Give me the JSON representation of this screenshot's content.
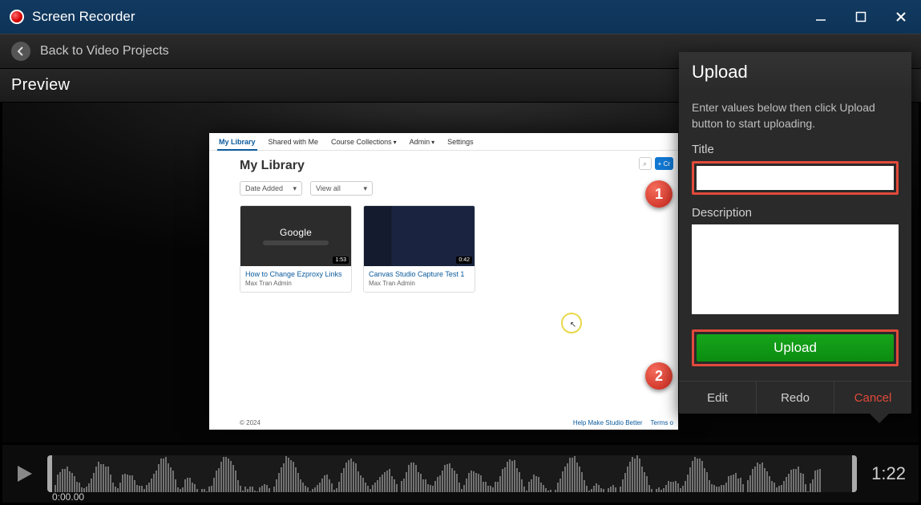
{
  "titlebar": {
    "app_name": "Screen Recorder"
  },
  "navbar": {
    "back_label": "Back to Video Projects"
  },
  "preview": {
    "heading": "Preview"
  },
  "canvas": {
    "nav": {
      "my_library": "My Library",
      "shared": "Shared with Me",
      "collections": "Course Collections",
      "admin": "Admin",
      "settings": "Settings"
    },
    "page_title": "My Library",
    "create_label": "+  Cr",
    "filters": {
      "sort": "Date Added",
      "view": "View all"
    },
    "cards": [
      {
        "title": "How to Change Ezproxy Links",
        "author": "Max Tran Admin",
        "duration": "1:53",
        "thumb": "google",
        "thumb_text": "Google"
      },
      {
        "title": "Canvas Studio Capture Test 1",
        "author": "Max Tran Admin",
        "duration": "0:42",
        "thumb": "code",
        "thumb_text": ""
      }
    ],
    "footer": {
      "copyright": "© 2024",
      "link1": "Help Make Studio Better",
      "link2": "Terms o"
    }
  },
  "badges": {
    "one": "1",
    "two": "2"
  },
  "upload": {
    "heading": "Upload",
    "help": "Enter values below then click Upload button to start uploading.",
    "title_label": "Title",
    "title_value": "",
    "desc_label": "Description",
    "desc_value": "",
    "upload_btn": "Upload",
    "edit": "Edit",
    "redo": "Redo",
    "cancel": "Cancel"
  },
  "player": {
    "position": "0:00.00",
    "duration": "1:22"
  }
}
